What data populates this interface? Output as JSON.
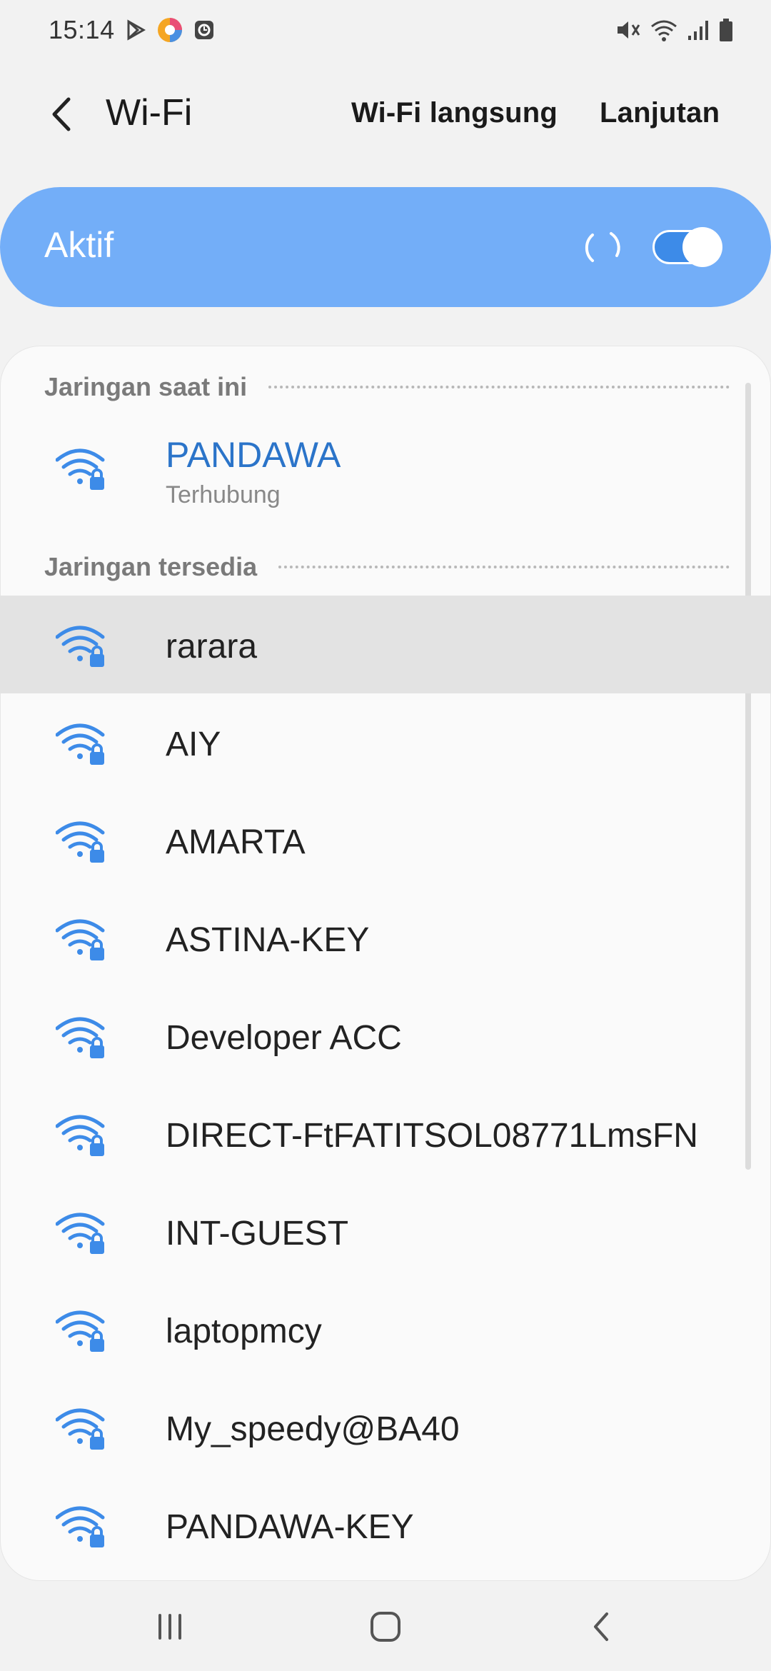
{
  "status_bar": {
    "time": "15:14",
    "left_icons": [
      "play-store-icon",
      "colorful-app-icon",
      "clock-app-icon"
    ],
    "right_icons": [
      "mute-icon",
      "wifi-signal-icon",
      "cell-signal-icon",
      "battery-icon"
    ]
  },
  "header": {
    "title": "Wi-Fi",
    "action_direct": "Wi-Fi langsung",
    "action_advanced": "Lanjutan"
  },
  "master_toggle": {
    "label": "Aktif",
    "enabled": true
  },
  "sections": {
    "current_title": "Jaringan saat ini",
    "available_title": "Jaringan tersedia"
  },
  "current_network": {
    "name": "PANDAWA",
    "status": "Terhubung"
  },
  "available_networks": [
    {
      "name": "rarara",
      "secured": true,
      "selected": true
    },
    {
      "name": "AIY",
      "secured": true
    },
    {
      "name": "AMARTA",
      "secured": true
    },
    {
      "name": "ASTINA-KEY",
      "secured": true
    },
    {
      "name": "Developer ACC",
      "secured": true
    },
    {
      "name": "DIRECT-FtFATITSOL08771LmsFN",
      "secured": true
    },
    {
      "name": "INT-GUEST",
      "secured": true
    },
    {
      "name": "laptopmcy",
      "secured": true
    },
    {
      "name": "My_speedy@BA40",
      "secured": true
    },
    {
      "name": "PANDAWA-KEY",
      "secured": true
    }
  ],
  "colors": {
    "accent": "#73aef8",
    "wifi_icon": "#3d8be8",
    "connected_text": "#2b74c9"
  },
  "nav_bar": {
    "buttons": [
      "recent-apps-icon",
      "home-icon",
      "back-icon"
    ]
  }
}
